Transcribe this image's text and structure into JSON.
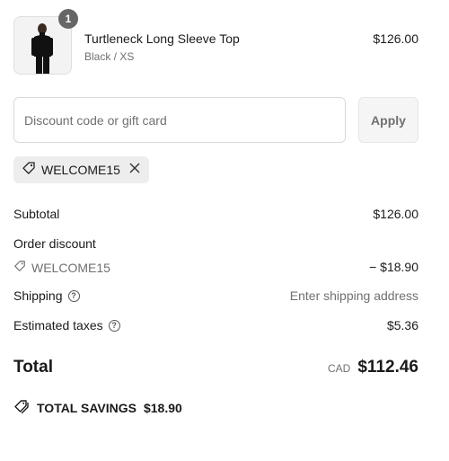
{
  "product": {
    "quantity": "1",
    "name": "Turtleneck Long Sleeve Top",
    "variant": "Black / XS",
    "price": "$126.00"
  },
  "discount": {
    "placeholder": "Discount code or gift card",
    "apply_label": "Apply",
    "applied_code": "WELCOME15"
  },
  "summary": {
    "subtotal_label": "Subtotal",
    "subtotal_value": "$126.00",
    "order_discount_label": "Order discount",
    "discount_code": "WELCOME15",
    "discount_value": "− $18.90",
    "shipping_label": "Shipping",
    "shipping_value": "Enter shipping address",
    "taxes_label": "Estimated taxes",
    "taxes_value": "$5.36",
    "total_label": "Total",
    "currency": "CAD",
    "total_value": "$112.46"
  },
  "savings": {
    "label": "TOTAL SAVINGS",
    "value": "$18.90"
  },
  "icons": [
    "tag-icon",
    "close-icon",
    "help-icon",
    "tags-icon"
  ],
  "colors": {
    "badge": "#666666",
    "muted": "#707070",
    "chip_bg": "#ededed"
  }
}
